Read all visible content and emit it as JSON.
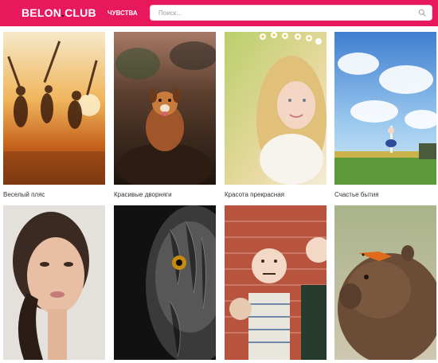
{
  "header": {
    "logo_main": "BELON",
    "logo_dot": ".",
    "logo_club": "CLUB",
    "nav_label": "ЧУВСТВА",
    "search_placeholder": "Поиск...",
    "brand_color": "#e8185c"
  },
  "cards": [
    {
      "caption": "Веселый пляс",
      "image": "silhouettes-dancing-at-sunset"
    },
    {
      "caption": "Красивые дворняги",
      "image": "dog-sitting-on-tree-stump"
    },
    {
      "caption": "Красота прекрасная",
      "image": "blonde-girl-with-flower-wreath"
    },
    {
      "caption": "Счастье бытия",
      "image": "girl-under-blue-sky-illustration"
    },
    {
      "caption": "",
      "image": "woman-portrait"
    },
    {
      "caption": "",
      "image": "owl-closeup"
    },
    {
      "caption": "",
      "image": "people-with-smiley-masks-brick-wall"
    },
    {
      "caption": "",
      "image": "capybara-with-fish-on-head"
    }
  ]
}
